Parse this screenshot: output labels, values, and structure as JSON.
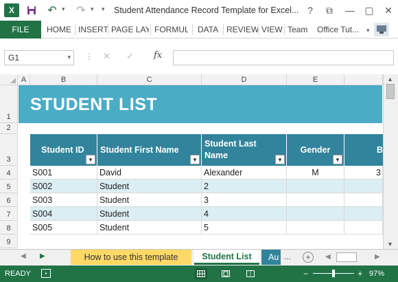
{
  "app": {
    "logo": "X",
    "title": "Student Attendance Record Template for Excel...",
    "help": "?",
    "restore": "⧉",
    "minimize": "—",
    "restore2": "▢",
    "close": "✕"
  },
  "ribbon": {
    "file": "FILE",
    "tabs": [
      "HOME",
      "INSERT",
      "PAGE LAY",
      "FORMUL",
      "DATA",
      "REVIEW",
      "VIEW",
      "Team"
    ],
    "user": "Office Tut...",
    "user_caret": "▾"
  },
  "formula_bar": {
    "name_box": "G1",
    "fx": "fx",
    "value": ""
  },
  "columns": [
    "A",
    "B",
    "C",
    "D",
    "E"
  ],
  "rows": [
    "1",
    "2",
    "3",
    "4",
    "5",
    "6",
    "7",
    "8",
    "9"
  ],
  "banner_title": "STUDENT LIST",
  "table": {
    "headers": [
      "Student ID",
      "Student First Name",
      "Student Last Name",
      "Gender",
      "B"
    ],
    "rows": [
      [
        "S001",
        "David",
        "Alexander",
        "M",
        "3"
      ],
      [
        "S002",
        "Student",
        "2",
        "",
        ""
      ],
      [
        "S003",
        "Student",
        "3",
        "",
        ""
      ],
      [
        "S004",
        "Student",
        "4",
        "",
        ""
      ],
      [
        "S005",
        "Student",
        "5",
        "",
        ""
      ]
    ]
  },
  "sheet_tabs": {
    "tabs": [
      "How to use this template",
      "Student List",
      "Au"
    ],
    "more": "...",
    "add": "+"
  },
  "status": {
    "ready": "READY",
    "zoom_minus": "−",
    "zoom_plus": "+",
    "zoom": "97%",
    "zoom_level": 97
  },
  "colors": {
    "excel_green": "#217346",
    "banner": "#4bacc6",
    "header": "#31849b",
    "band": "#dbeef4",
    "tab_yellow": "#ffd966"
  }
}
